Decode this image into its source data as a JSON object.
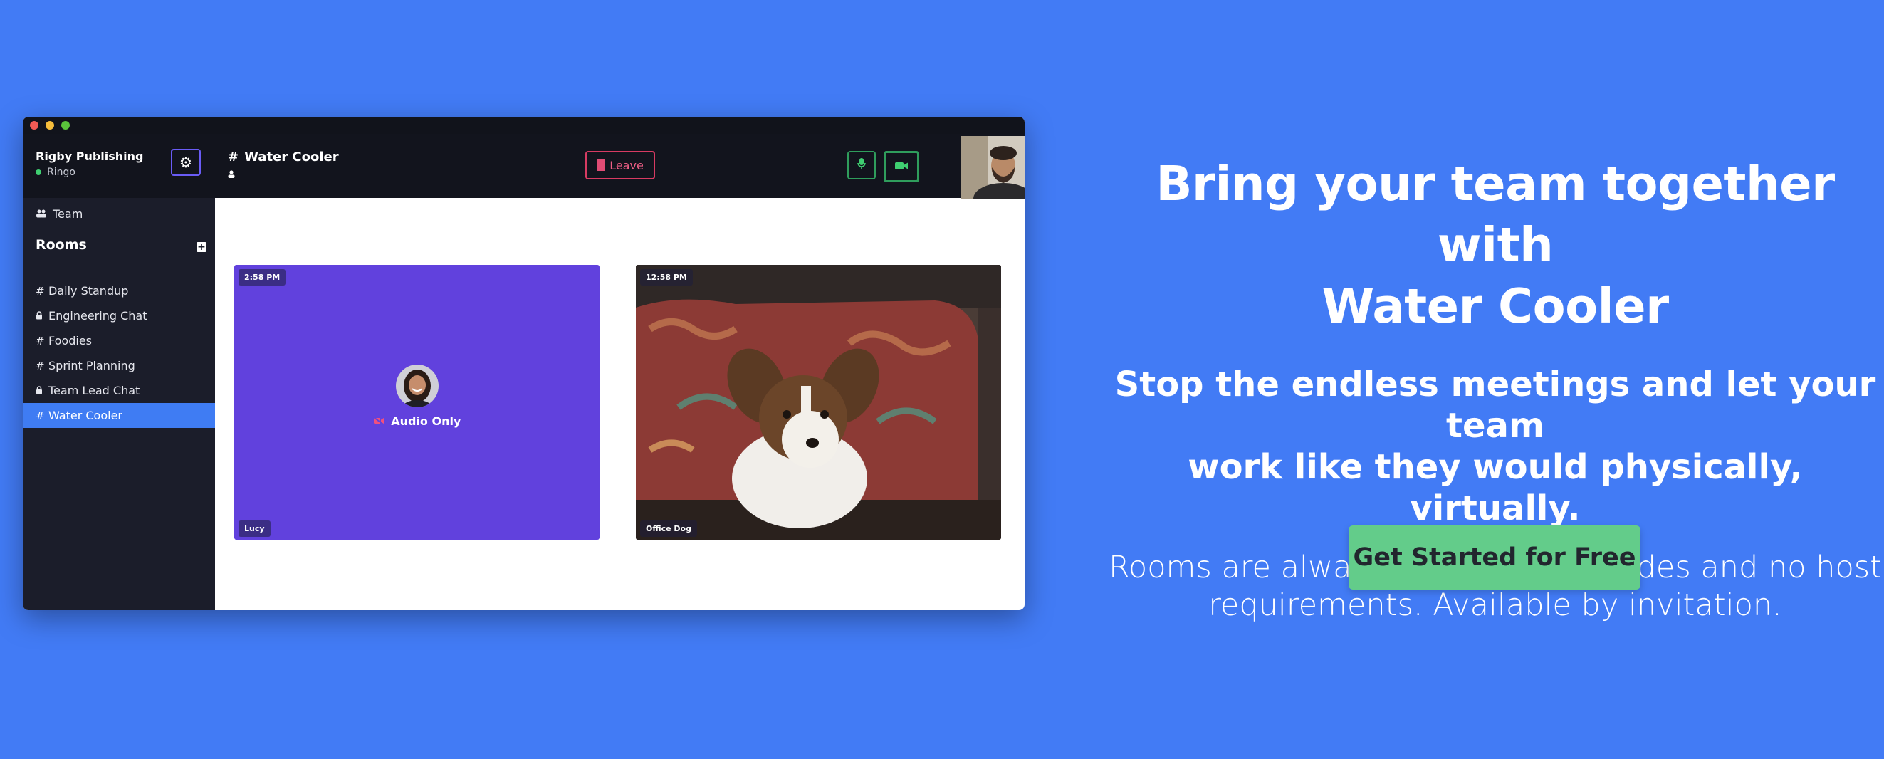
{
  "app": {
    "org_name": "Rigby Publishing",
    "user_name": "Ringo",
    "team_label": "Team",
    "rooms_heading": "Rooms",
    "rooms": [
      {
        "prefix": "#",
        "name": "Daily Standup",
        "locked": false,
        "active": false
      },
      {
        "prefix": "lock",
        "name": "Engineering Chat",
        "locked": true,
        "active": false
      },
      {
        "prefix": "#",
        "name": "Foodies",
        "locked": false,
        "active": false
      },
      {
        "prefix": "#",
        "name": "Sprint Planning",
        "locked": false,
        "active": false
      },
      {
        "prefix": "lock",
        "name": "Team Lead Chat",
        "locked": true,
        "active": false
      },
      {
        "prefix": "#",
        "name": "Water Cooler",
        "locked": false,
        "active": true
      }
    ],
    "room_header": {
      "hash": "#",
      "title": "Water Cooler",
      "leave_label": "Leave"
    },
    "tiles": [
      {
        "time": "2:58 PM",
        "name": "Lucy",
        "status": "Audio Only"
      },
      {
        "time": "12:58 PM",
        "name": "Office Dog"
      }
    ],
    "colors": {
      "accent": "#6a5cf6",
      "active_room": "#3f7cf3",
      "leave": "#d73b62",
      "media_button": "#2f9d5c",
      "presence": "#3fcf71"
    }
  },
  "hero": {
    "title_line1": "Bring your team together with",
    "title_line2": "Water Cooler",
    "subtitle_line1": "Stop the endless meetings and let your team",
    "subtitle_line2": "work like they would physically, virtually.",
    "desc_line1": "Rooms are always available, no codes and no host",
    "desc_line2": "requirements. Available by invitation.",
    "cta": "Get Started for Free"
  },
  "page": {
    "background": "#427bf5",
    "cta_color": "#63cc8a"
  }
}
